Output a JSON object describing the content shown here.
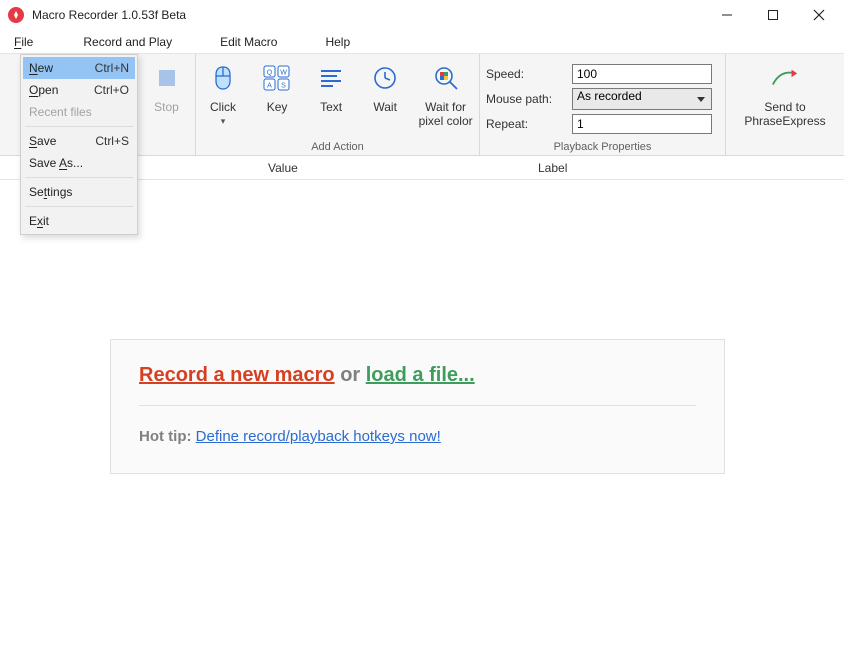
{
  "title": "Macro Recorder 1.0.53f Beta",
  "menu": {
    "file": "File",
    "record_play": "Record and Play",
    "edit_macro": "Edit Macro",
    "help": "Help"
  },
  "file_menu": {
    "new": "New",
    "new_shortcut": "Ctrl+N",
    "open": "Open",
    "open_shortcut": "Ctrl+O",
    "recent": "Recent files",
    "save": "Save",
    "save_shortcut": "Ctrl+S",
    "save_as": "Save As...",
    "settings": "Settings",
    "exit": "Exit"
  },
  "ribbon": {
    "stop": "Stop",
    "click": "Click",
    "key": "Key",
    "text": "Text",
    "wait": "Wait",
    "wait_pixel": "Wait for pixel color",
    "add_action_label": "Add Action",
    "playback_label": "Playback Properties",
    "speed_label": "Speed:",
    "speed_value": "100",
    "mousepath_label": "Mouse path:",
    "mousepath_value": "As recorded",
    "repeat_label": "Repeat:",
    "repeat_value": "1",
    "phrase_label": "Send to PhraseExpress"
  },
  "columns": {
    "value": "Value",
    "label": "Label"
  },
  "welcome": {
    "record": "Record a new macro",
    "or": "or",
    "load": "load a file...",
    "hot_tip": "Hot tip:",
    "hotkeys_link": "Define record/playback hotkeys now!"
  }
}
